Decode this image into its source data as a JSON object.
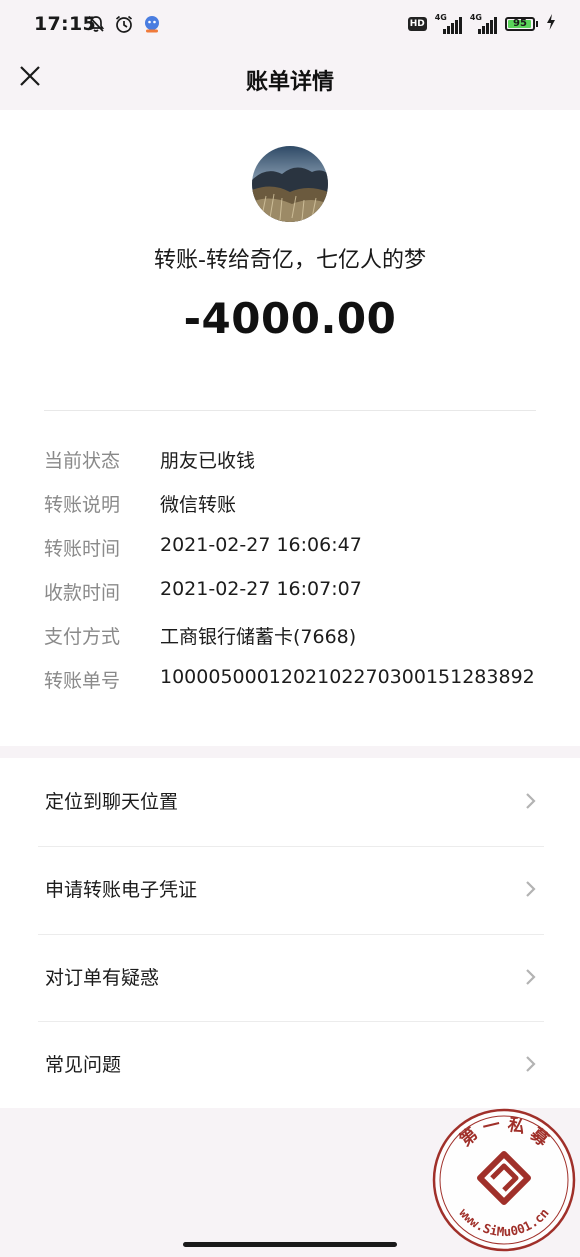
{
  "status_bar": {
    "time": "17:15",
    "hd": "HD",
    "network_1": "4G",
    "network_2": "4G",
    "battery": "95",
    "battery_level": 0.95
  },
  "nav": {
    "title": "账单详情",
    "close_icon": "close-icon"
  },
  "transaction": {
    "payee": "转账-转给奇亿，七亿人的梦",
    "amount": "-4000.00"
  },
  "details": [
    {
      "label": "当前状态",
      "value": "朋友已收钱"
    },
    {
      "label": "转账说明",
      "value": "微信转账"
    },
    {
      "label": "转账时间",
      "value": "2021-02-27 16:06:47"
    },
    {
      "label": "收款时间",
      "value": "2021-02-27 16:07:07"
    },
    {
      "label": "支付方式",
      "value": "工商银行储蓄卡(7668)"
    },
    {
      "label": "转账单号",
      "value": "1000050001202102270300151283892"
    }
  ],
  "menu": [
    {
      "label": "定位到聊天位置"
    },
    {
      "label": "申请转账电子凭证"
    },
    {
      "label": "对订单有疑惑"
    },
    {
      "label": "常见问题"
    }
  ],
  "watermark": {
    "top_text": "第 一 私 募",
    "bottom_text": "www.SiMu001.cn"
  },
  "colors": {
    "background": "#f7f3f6",
    "card": "#ffffff",
    "label_gray": "#8a8a8a",
    "watermark_red": "#a0302a",
    "battery_green": "#5ad45a"
  }
}
